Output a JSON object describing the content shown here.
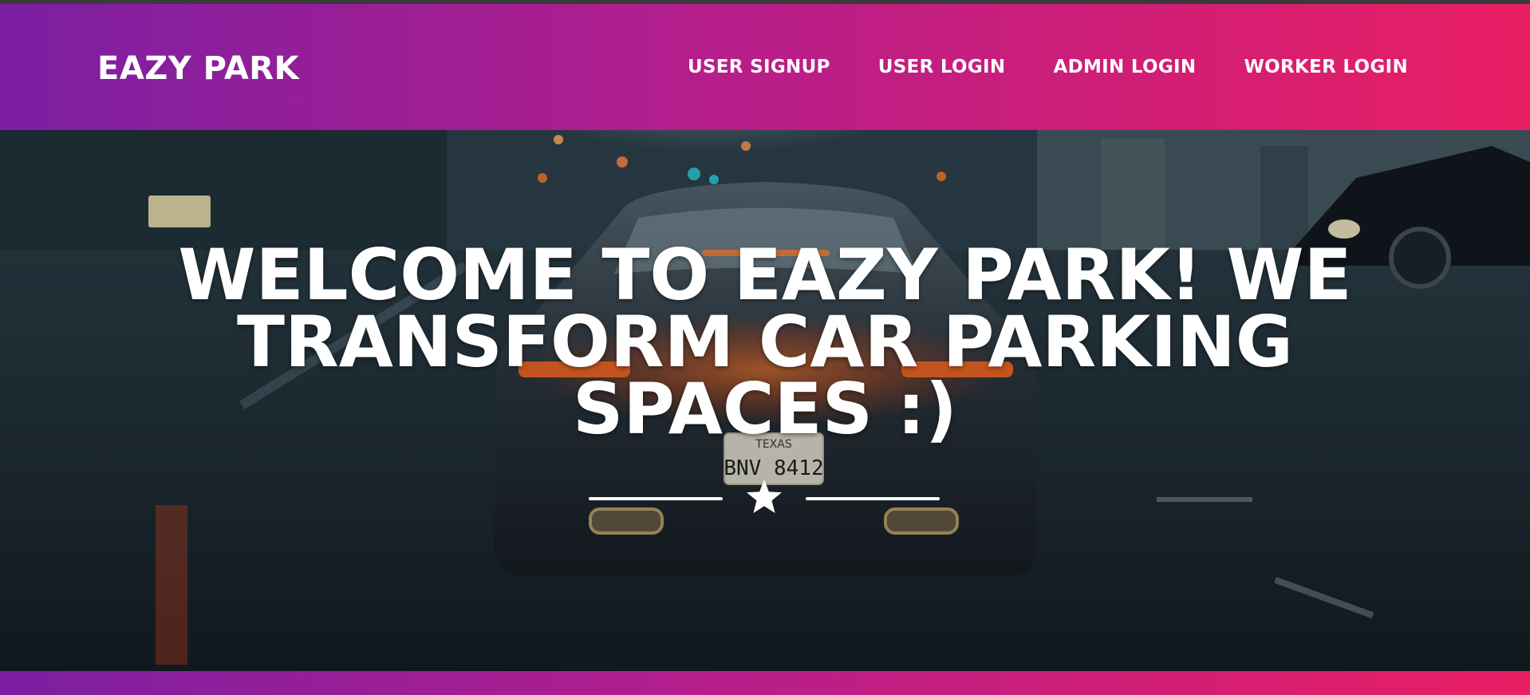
{
  "brand": {
    "name": "EAZY PARK"
  },
  "nav": {
    "items": [
      {
        "label": "USER SIGNUP"
      },
      {
        "label": "USER LOGIN"
      },
      {
        "label": "ADMIN LOGIN"
      },
      {
        "label": "WORKER LOGIN"
      }
    ]
  },
  "hero": {
    "headline": "WELCOME TO EAZY PARK! WE TRANSFORM CAR PARKING SPACES :)",
    "divider_icon": "star-icon",
    "plate_state": "TEXAS",
    "plate_number": "BNV 8412"
  },
  "colors": {
    "gradient_start": "#7b1fa2",
    "gradient_end": "#e91e63",
    "text": "#ffffff"
  }
}
